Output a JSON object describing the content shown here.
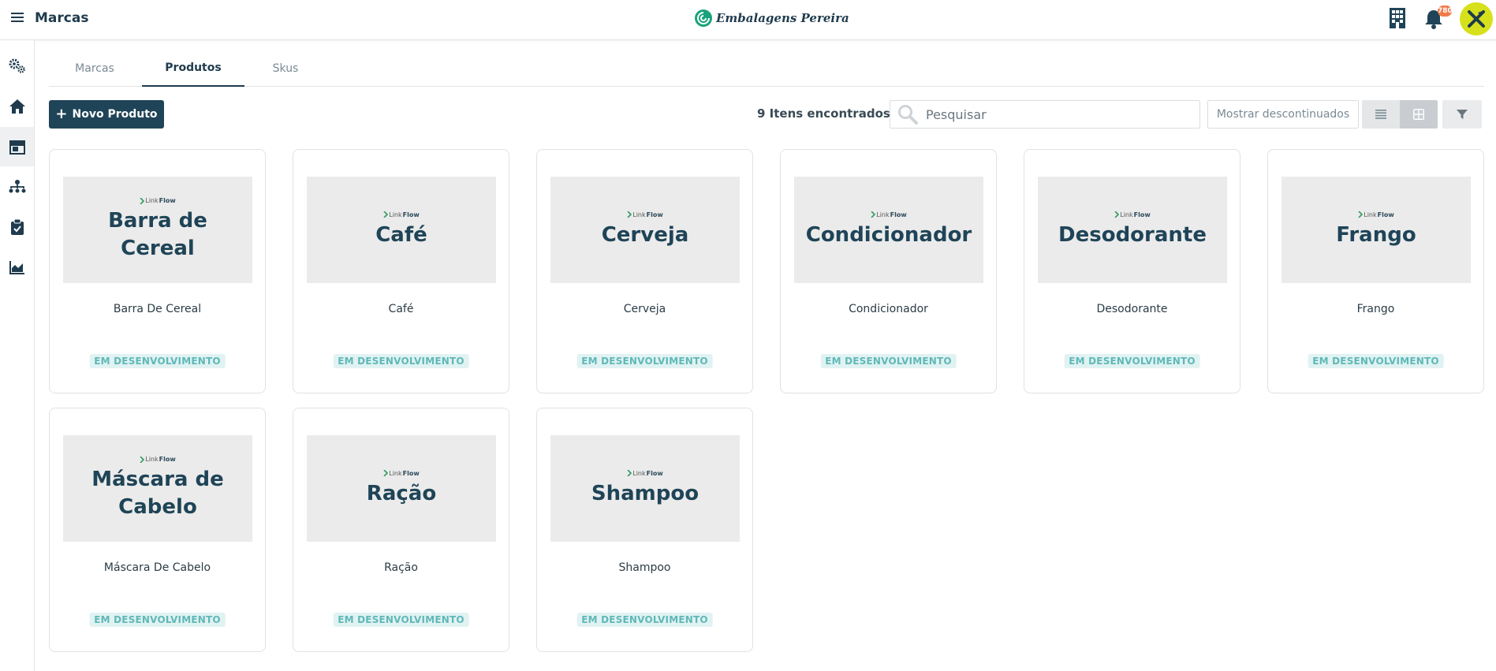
{
  "header": {
    "title": "Marcas",
    "brand_name": "Embalagens Pereira",
    "notifications_count": "780",
    "icons": [
      "menu-icon",
      "building-icon",
      "bell-icon",
      "user-avatar"
    ]
  },
  "sidebar": {
    "items": [
      {
        "icon": "gears-icon"
      },
      {
        "icon": "home-icon"
      },
      {
        "icon": "store-icon",
        "active": true
      },
      {
        "icon": "network-icon"
      },
      {
        "icon": "clipboard-check-icon"
      },
      {
        "icon": "chart-area-icon"
      }
    ]
  },
  "tabs": [
    {
      "label": "Marcas"
    },
    {
      "label": "Produtos",
      "active": true
    },
    {
      "label": "Skus"
    }
  ],
  "toolbar": {
    "new_button_label": "Novo Produto",
    "result_count": "9 Itens encontrados",
    "search_placeholder": "Pesquisar",
    "show_discontinued_label": "Mostrar descontinuados"
  },
  "products": [
    {
      "image_title": "Barra de Cereal",
      "name": "Barra De Cereal",
      "status": "EM DESENVOLVIMENTO"
    },
    {
      "image_title": "Café",
      "name": "Café",
      "status": "EM DESENVOLVIMENTO"
    },
    {
      "image_title": "Cerveja",
      "name": "Cerveja",
      "status": "EM DESENVOLVIMENTO"
    },
    {
      "image_title": "Condicionador",
      "name": "Condicionador",
      "status": "EM DESENVOLVIMENTO"
    },
    {
      "image_title": "Desodorante",
      "name": "Desodorante",
      "status": "EM DESENVOLVIMENTO"
    },
    {
      "image_title": "Frango",
      "name": "Frango",
      "status": "EM DESENVOLVIMENTO"
    },
    {
      "image_title": "Máscara de Cabelo",
      "name": "Máscara De Cabelo",
      "status": "EM DESENVOLVIMENTO"
    },
    {
      "image_title": "Ração",
      "name": "Ração",
      "status": "EM DESENVOLVIMENTO"
    },
    {
      "image_title": "Shampoo",
      "name": "Shampoo",
      "status": "EM DESENVOLVIMENTO"
    }
  ],
  "placeholder_logo": {
    "part1": "Link",
    "part2": "Flow"
  },
  "colors": {
    "primary": "#1f4457",
    "badge_bg": "#e1f2f2",
    "badge_text": "#5fb8b8",
    "avatar_bg": "#d6e11b",
    "notification_badge": "#f07b4a"
  }
}
